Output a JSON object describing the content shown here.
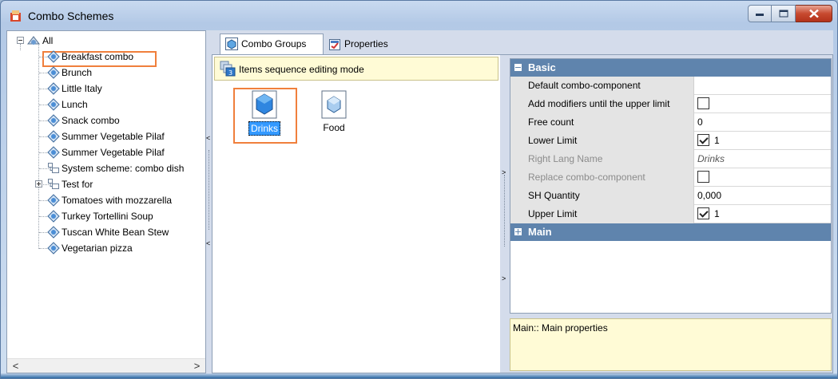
{
  "window": {
    "title": "Combo Schemes"
  },
  "tree": {
    "root": "All",
    "items": [
      {
        "label": "Breakfast combo",
        "type": "combo"
      },
      {
        "label": "Brunch",
        "type": "combo"
      },
      {
        "label": "Little Italy",
        "type": "combo"
      },
      {
        "label": "Lunch",
        "type": "combo"
      },
      {
        "label": "Snack combo",
        "type": "combo"
      },
      {
        "label": "Summer Vegetable Pilaf",
        "type": "combo"
      },
      {
        "label": "Summer Vegetable Pilaf",
        "type": "combo"
      },
      {
        "label": "System scheme: combo dish",
        "type": "folder"
      },
      {
        "label": "Test for",
        "type": "folder"
      },
      {
        "label": "Tomatoes with mozzarella",
        "type": "combo"
      },
      {
        "label": "Turkey Tortellini Soup",
        "type": "combo"
      },
      {
        "label": "Tuscan White Bean Stew",
        "type": "combo"
      },
      {
        "label": "Vegetarian pizza",
        "type": "combo"
      }
    ]
  },
  "tabs": [
    {
      "label": "Combo Groups",
      "active": true
    },
    {
      "label": "Properties",
      "active": false
    }
  ],
  "groups": {
    "mode_text": "Items sequence editing mode",
    "items": [
      {
        "label": "Drinks",
        "selected": true
      },
      {
        "label": "Food",
        "selected": false
      }
    ]
  },
  "properties": {
    "basic_category": "Basic",
    "main_category": "Main",
    "rows": [
      {
        "name": "Default combo-component",
        "value": "",
        "kind": "text",
        "disabled": false
      },
      {
        "name": "Add modifiers until the upper limit",
        "value": "",
        "kind": "check-off",
        "disabled": false
      },
      {
        "name": "Free count",
        "value": "0",
        "kind": "text",
        "disabled": false
      },
      {
        "name": "Lower Limit",
        "value": "1",
        "kind": "check-on",
        "disabled": false
      },
      {
        "name": "Right Lang Name",
        "value": "Drinks",
        "kind": "italic",
        "disabled": true
      },
      {
        "name": "Replace combo-component",
        "value": "",
        "kind": "check-off",
        "disabled": true
      },
      {
        "name": "SH Quantity",
        "value": "0,000",
        "kind": "text",
        "disabled": false
      },
      {
        "name": "Upper Limit",
        "value": "1",
        "kind": "check-on",
        "disabled": false
      }
    ],
    "description": "Main:: Main properties"
  },
  "colors": {
    "highlight": "#f07f3c",
    "category": "#5f84ad",
    "selection": "#3399ff"
  }
}
